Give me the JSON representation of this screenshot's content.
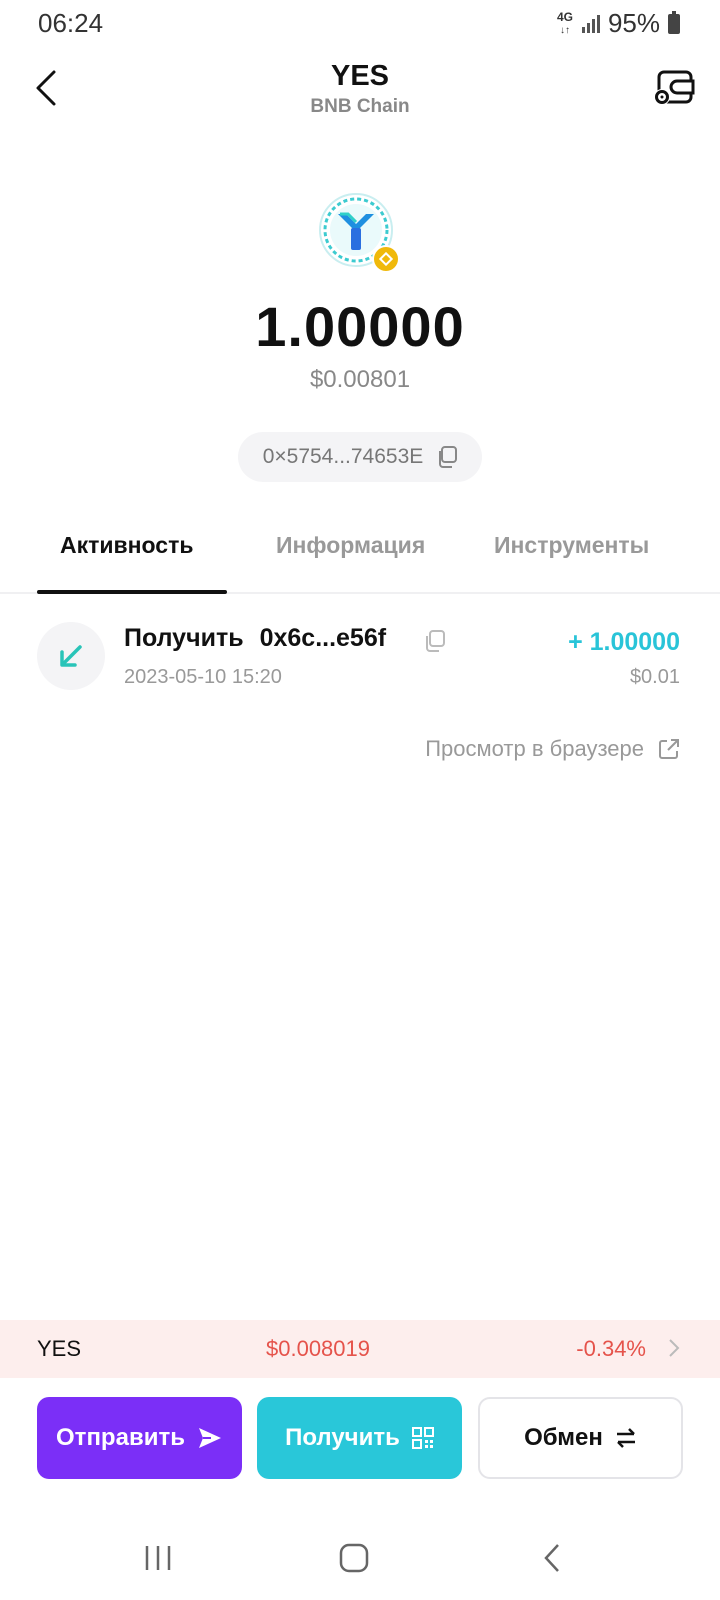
{
  "status_bar": {
    "time": "06:24",
    "network": "4G",
    "battery": "95%"
  },
  "header": {
    "title": "YES",
    "subtitle": "BNB Chain",
    "back_icon": "chevron-left-icon",
    "settings_icon": "wallet-settings-icon"
  },
  "token": {
    "logo_icon": "yes-token-logo",
    "chain_badge_icon": "bnb-badge-icon",
    "balance": "1.00000",
    "balance_usd": "$0.00801",
    "address": "0×5754...74653E"
  },
  "tabs": [
    {
      "label": "Активность",
      "active": true
    },
    {
      "label": "Информация",
      "active": false
    },
    {
      "label": "Инструменты",
      "active": false
    }
  ],
  "transactions": [
    {
      "type_label": "Получить",
      "counterparty": "0x6c...e56f",
      "date": "2023-05-10 15:20",
      "amount": "+ 1.00000",
      "amount_usd": "$0.01"
    }
  ],
  "explorer_link": "Просмотр в браузере",
  "ticker": {
    "symbol": "YES",
    "price": "$0.008019",
    "change": "-0.34%"
  },
  "actions": {
    "send_label": "Отправить",
    "receive_label": "Получить",
    "swap_label": "Обмен"
  },
  "colors": {
    "send": "#7b2ff7",
    "receive": "#29c7d9",
    "positive": "#29c4d8",
    "negative": "#e5534b"
  }
}
